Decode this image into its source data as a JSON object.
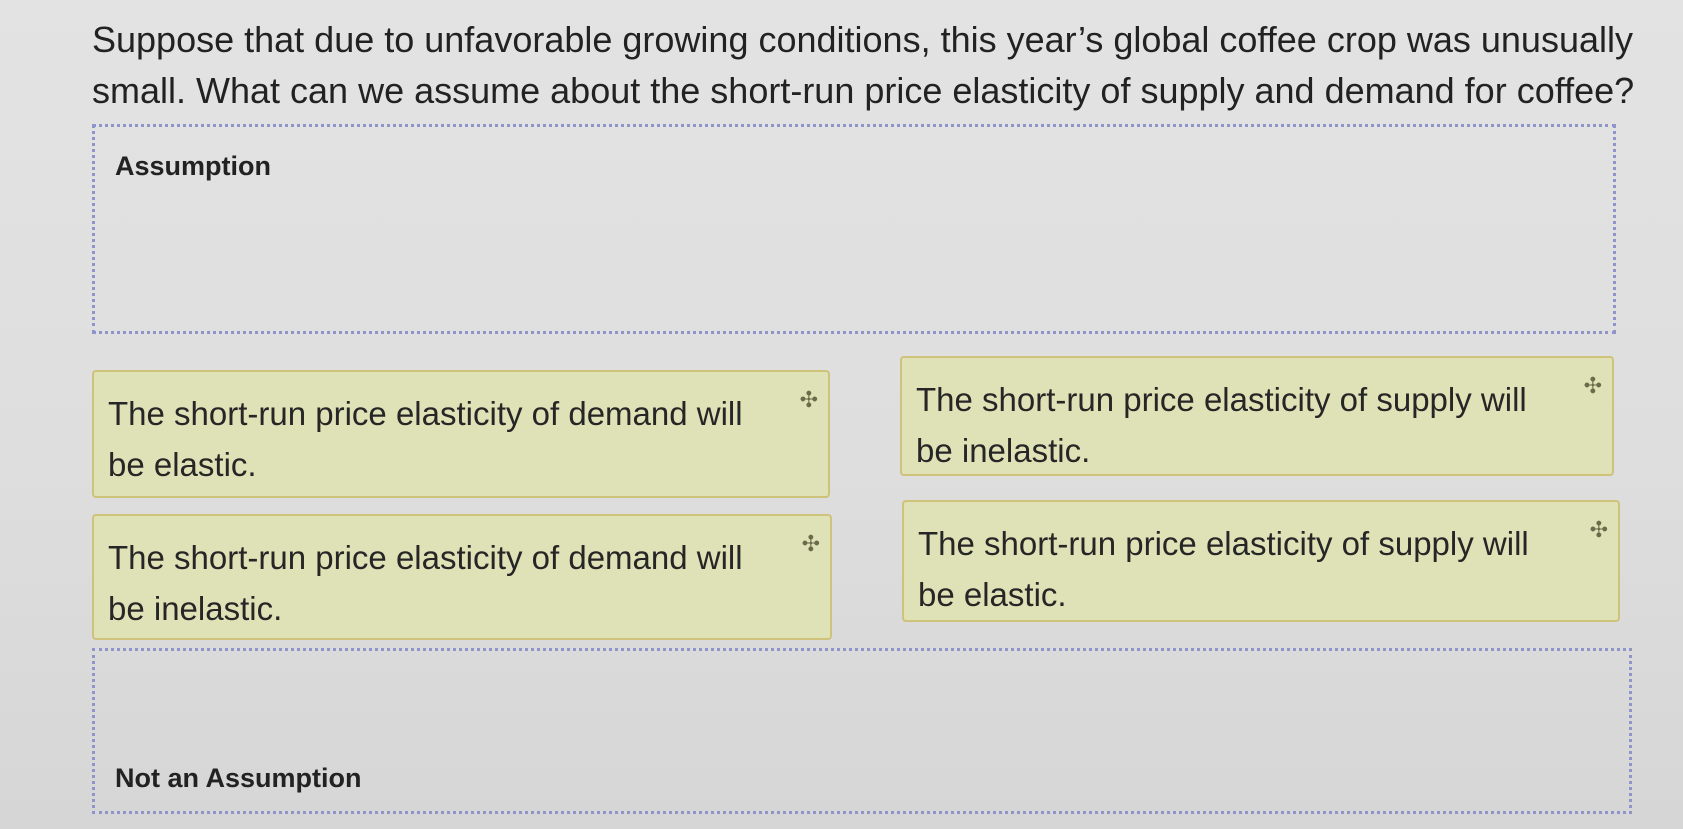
{
  "question": "Suppose that due to unfavorable growing conditions, this year’s global coffee crop was unusually small. What can we assume about the short-run price elasticity of supply and demand for coffee?",
  "zones": {
    "assumption_label": "Assumption",
    "not_assumption_label": "Not an Assumption"
  },
  "cards": [
    {
      "text": "The short-run price elasticity of demand will be elastic.",
      "icon": "move-icon"
    },
    {
      "text": "The short-run price elasticity of supply will be inelastic.",
      "icon": "move-icon"
    },
    {
      "text": "The short-run price elasticity of demand will be inelastic.",
      "icon": "move-icon"
    },
    {
      "text": "The short-run price elasticity of supply will be elastic.",
      "icon": "move-icon"
    }
  ],
  "colors": {
    "card_background": "#dfe1b6",
    "card_border": "#cfc27a",
    "dropzone_border": "#8f95c9"
  }
}
